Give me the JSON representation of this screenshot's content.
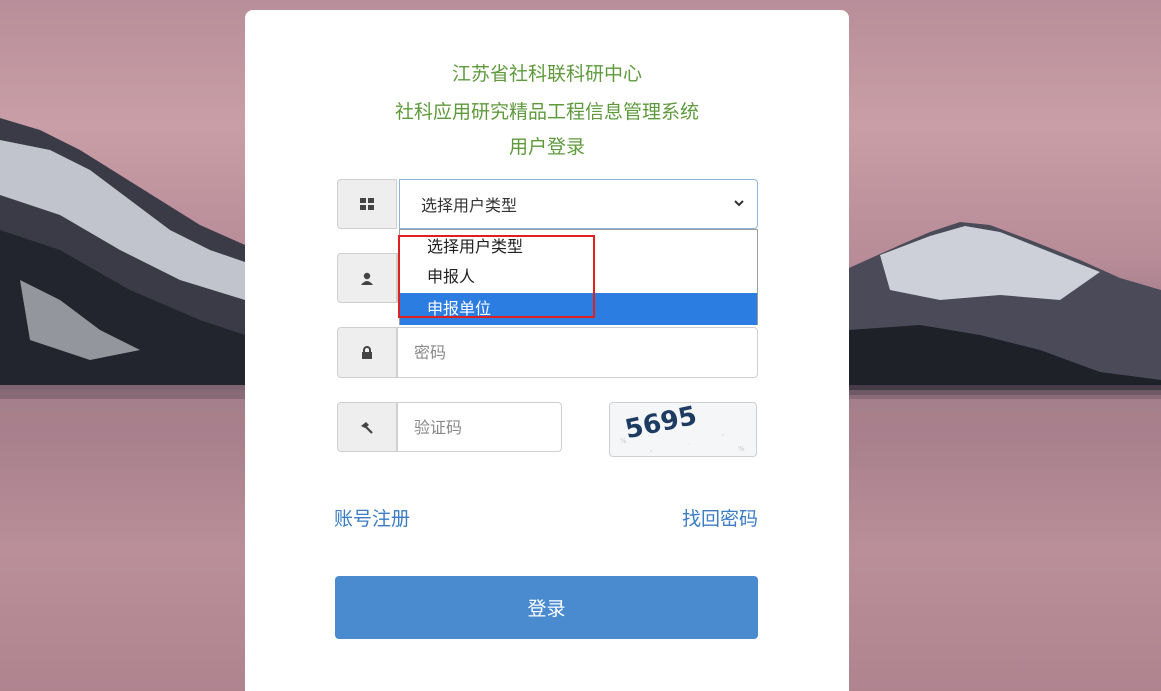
{
  "header": {
    "line1": "江苏省社科联科研中心",
    "line2": "社科应用研究精品工程信息管理系统",
    "line3": "用户登录"
  },
  "user_type": {
    "selected": "选择用户类型",
    "icon": "grid-icon",
    "options": [
      "选择用户类型",
      "申报人",
      "申报单位"
    ],
    "highlighted_option": "申报单位"
  },
  "username": {
    "icon": "user-icon",
    "placeholder": ""
  },
  "password": {
    "icon": "lock-icon",
    "placeholder": "密码"
  },
  "captcha": {
    "icon": "hammer-icon",
    "placeholder": "验证码",
    "image_text": "5695"
  },
  "links": {
    "register": "账号注册",
    "forgot_password": "找回密码"
  },
  "login_button": "登录",
  "colors": {
    "title_green": "#5e9a3c",
    "link_blue": "#3b7cc4",
    "button_blue": "#4a8bd0",
    "highlight_blue": "#2b7de1",
    "annotation_red": "#e02020"
  }
}
